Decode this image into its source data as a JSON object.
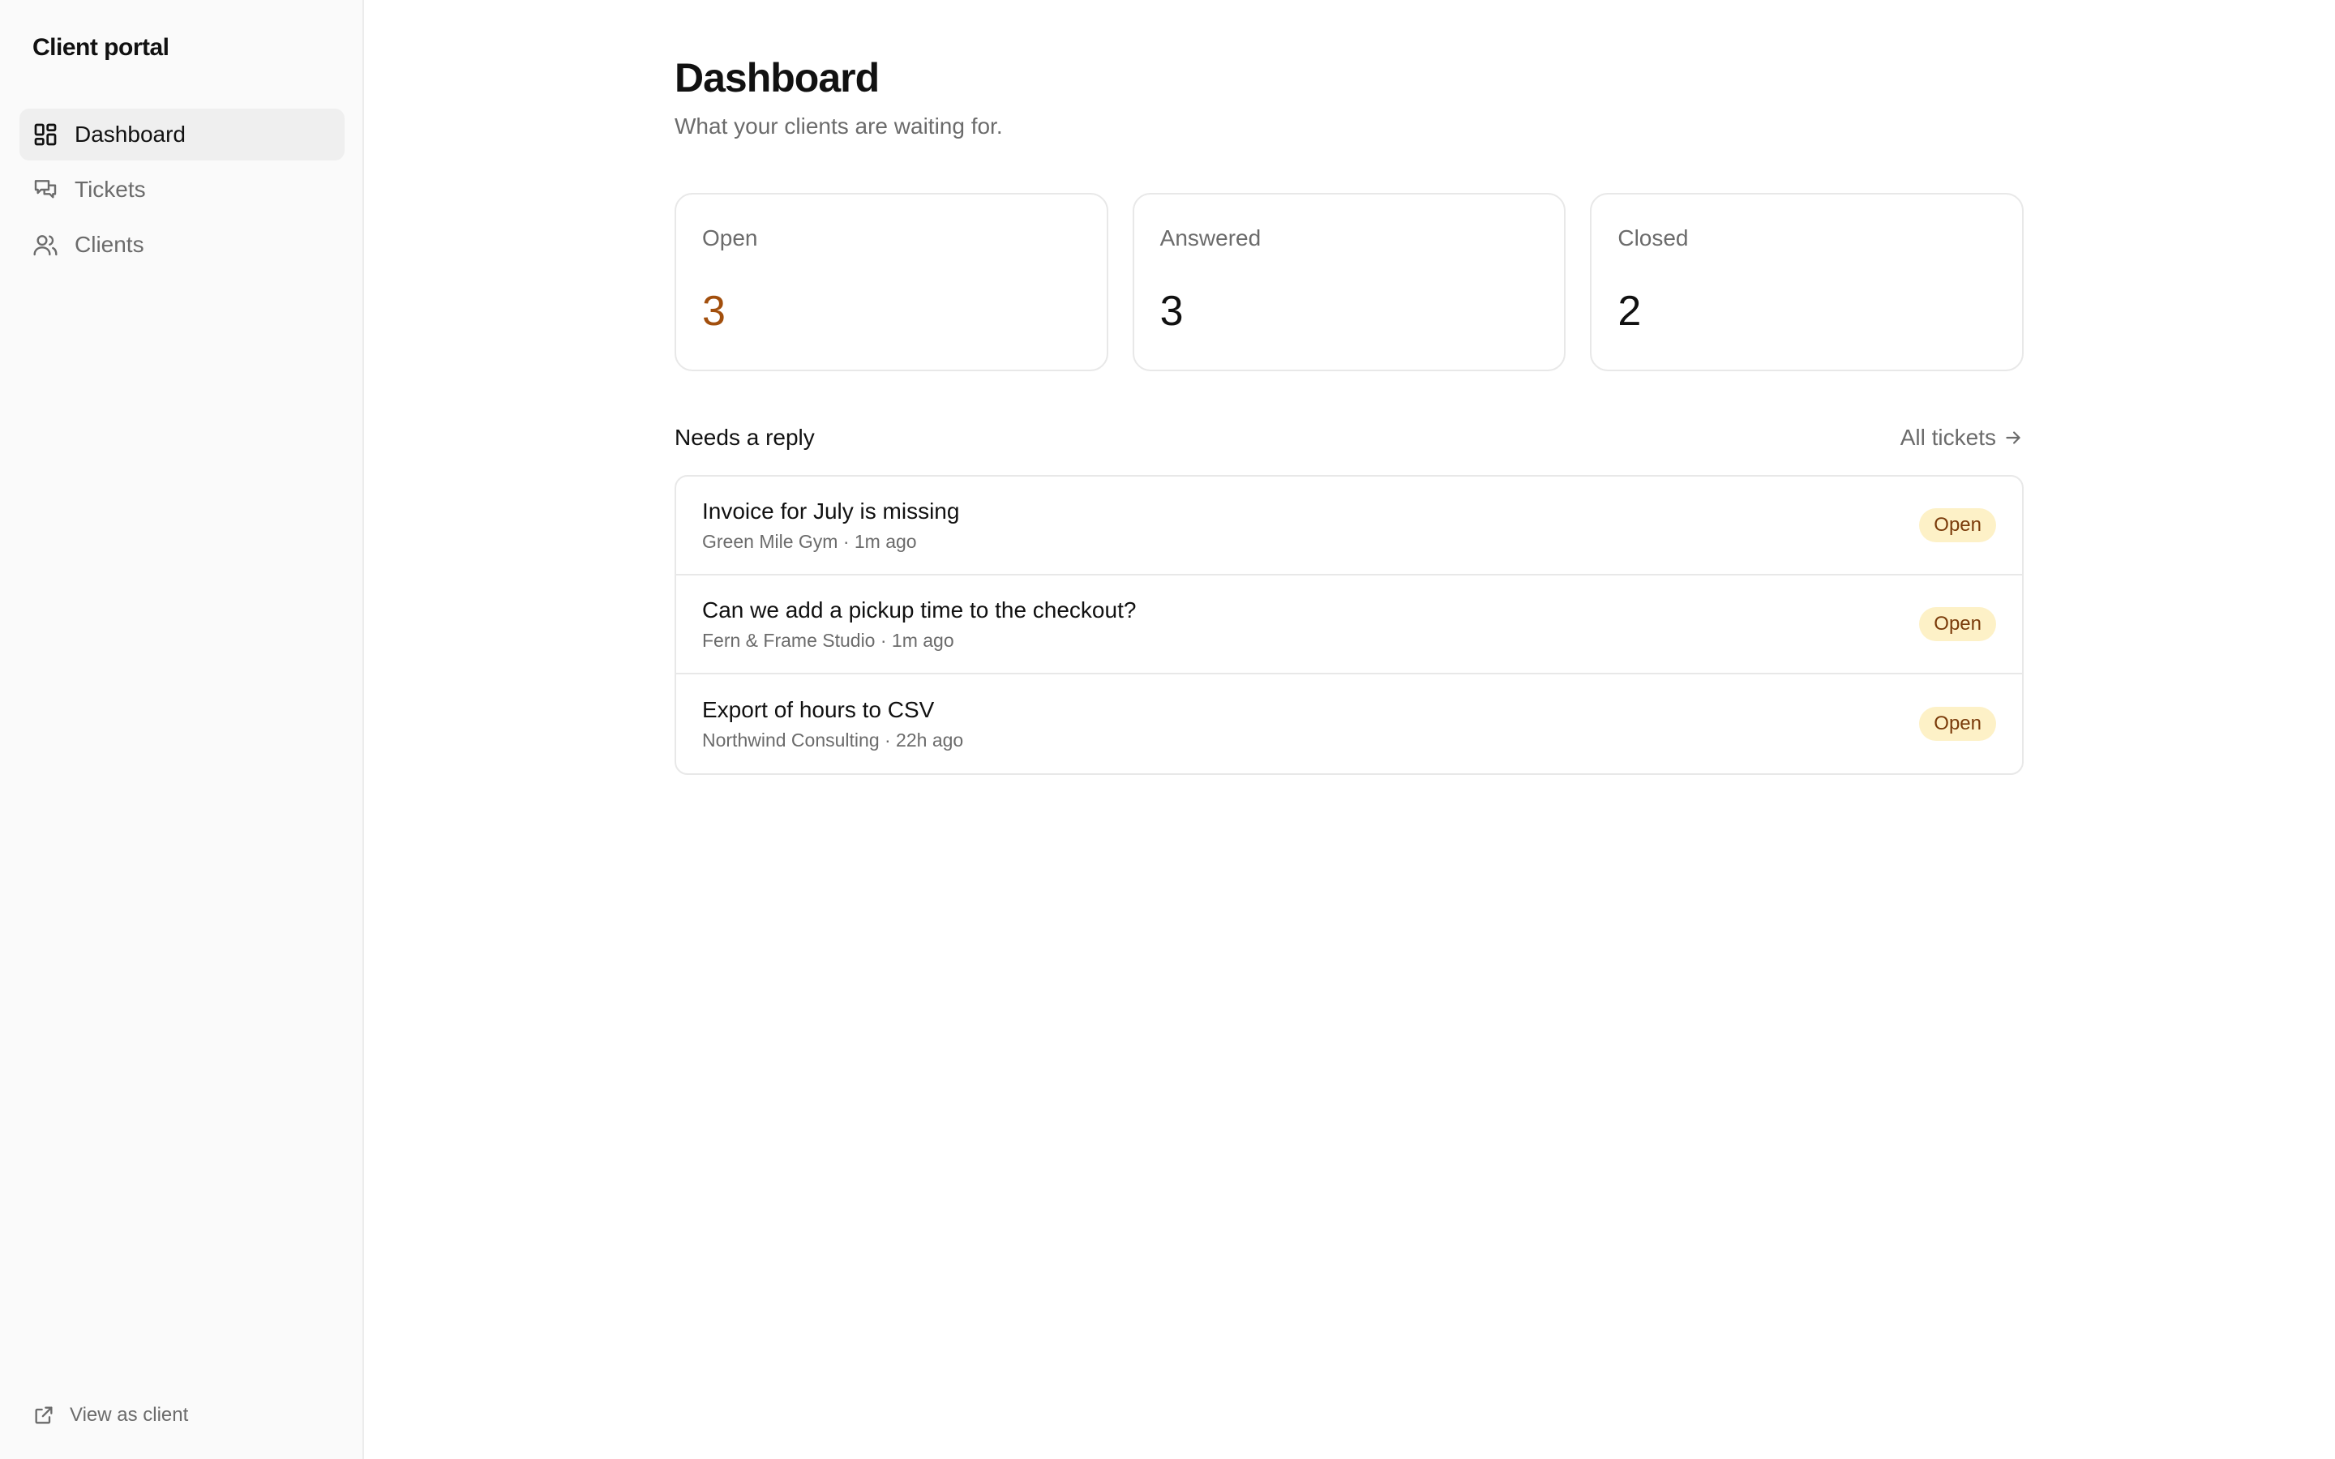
{
  "app": {
    "brand": "Client portal"
  },
  "sidebar": {
    "items": [
      {
        "label": "Dashboard",
        "icon": "dashboard-grid-icon",
        "active": true
      },
      {
        "label": "Tickets",
        "icon": "chat-bubbles-icon",
        "active": false
      },
      {
        "label": "Clients",
        "icon": "users-icon",
        "active": false
      }
    ],
    "footer": {
      "label": "View as client",
      "icon": "external-link-icon"
    }
  },
  "page": {
    "title": "Dashboard",
    "subtitle": "What your clients are waiting for."
  },
  "stats": [
    {
      "label": "Open",
      "value": "3",
      "color": "#a24f0d"
    },
    {
      "label": "Answered",
      "value": "3",
      "color": "#111111"
    },
    {
      "label": "Closed",
      "value": "2",
      "color": "#111111"
    }
  ],
  "needs_reply": {
    "title": "Needs a reply",
    "link_label": "All tickets",
    "link_icon": "arrow-right-icon",
    "tickets": [
      {
        "title": "Invoice for July is missing",
        "meta": "Green Mile Gym · 1m ago",
        "status": "Open"
      },
      {
        "title": "Can we add a pickup time to the checkout?",
        "meta": "Fern & Frame Studio · 1m ago",
        "status": "Open"
      },
      {
        "title": "Export of hours to CSV",
        "meta": "Northwind Consulting · 22h ago",
        "status": "Open"
      }
    ]
  },
  "colors": {
    "accent": "#a24f0d",
    "badge_bg": "#fdf1c7",
    "badge_text": "#7a3b0a",
    "sidebar_bg": "#fafafa",
    "active_item_bg": "#efefef"
  }
}
